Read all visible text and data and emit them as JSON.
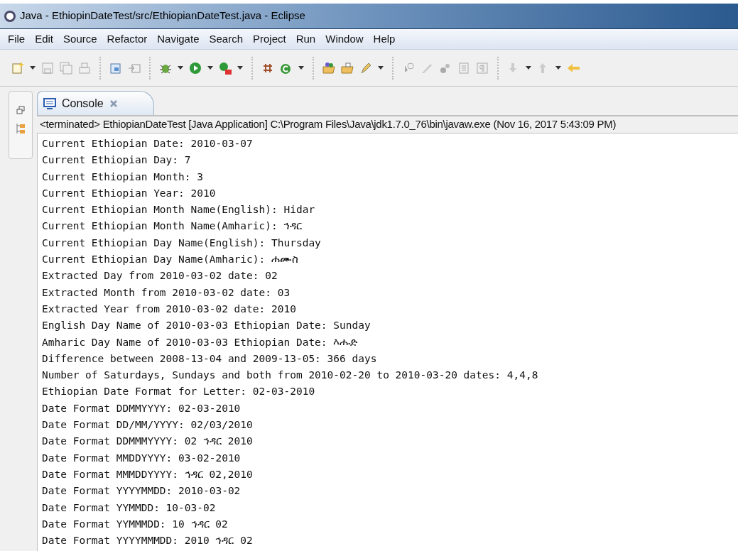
{
  "window": {
    "title": "Java - EthiopinDateTest/src/EthiopianDateTest.java - Eclipse"
  },
  "menu": [
    "File",
    "Edit",
    "Source",
    "Refactor",
    "Navigate",
    "Search",
    "Project",
    "Run",
    "Window",
    "Help"
  ],
  "tabs": [
    {
      "label": "Console",
      "selected": true
    }
  ],
  "console": {
    "header": "<terminated> EthiopianDateTest [Java Application] C:\\Program Files\\Java\\jdk1.7.0_76\\bin\\javaw.exe (Nov 16, 2017 5:43:09 PM)",
    "lines": [
      "Current Ethiopian Date: 2010-03-07",
      "Current Ethiopian Day: 7",
      "Current Ethiopian Month: 3",
      "Current Ethiopian Year: 2010",
      "Current Ethiopian Month Name(English): Hidar",
      "Current Ethiopian Month Name(Amharic): ኅዳር",
      "Current Ethiopian Day Name(English): Thursday",
      "Current Ethiopian Day Name(Amharic): ሐሙስ",
      "Extracted Day from 2010-03-02 date: 02",
      "Extracted Month from 2010-03-02 date: 03",
      "Extracted Year from 2010-03-02 date: 2010",
      "English Day Name of 2010-03-03 Ethiopian Date: Sunday",
      "Amharic Day Name of 2010-03-03 Ethiopian Date: እሑድ",
      "Difference between 2008-13-04 and 2009-13-05: 366 days",
      "Number of Saturdays, Sundays and both from 2010-02-20 to 2010-03-20 dates: 4,4,8",
      "Ethiopian Date Format for Letter: 02-03-2010",
      "Date Format DDMMYYYY: 02-03-2010",
      "Date Format DD/MM/YYYY: 02/03/2010",
      "Date Format DDMMMYYYY: 02 ኅዳር 2010",
      "Date Format MMDDYYYY: 03-02-2010",
      "Date Format MMMDDYYYY: ኅዳር 02,2010",
      "Date Format YYYYMMDD: 2010-03-02",
      "Date Format YYMMDD: 10-03-02",
      "Date Format YYMMMDD: 10 ኅዳር 02",
      "Date Format YYYYMMMDD: 2010 ኅዳር 02"
    ]
  }
}
